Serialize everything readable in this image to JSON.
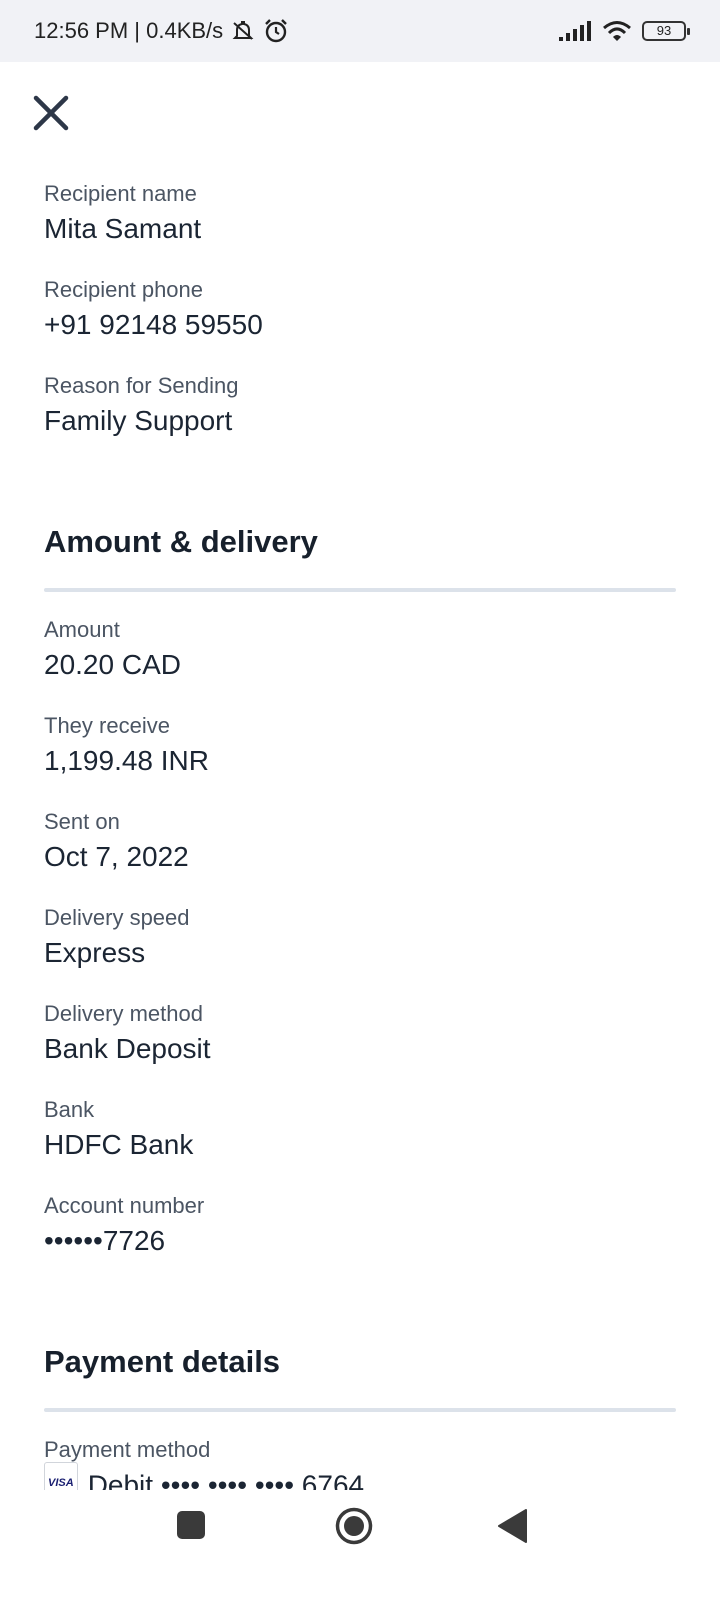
{
  "status_bar": {
    "time_speed": "12:56 PM | 0.4KB/s",
    "battery": "93",
    "icons": [
      "mute-icon",
      "alarm-icon",
      "signal-icon",
      "wifi-icon",
      "battery-icon"
    ]
  },
  "header": {
    "close_icon": "close-icon"
  },
  "recipient": [
    {
      "label": "Recipient name",
      "value": "Mita Samant"
    },
    {
      "label": "Recipient phone",
      "value": "+91 92148 59550"
    },
    {
      "label": "Reason for Sending",
      "value": "Family Support"
    }
  ],
  "amount_section": {
    "title": "Amount & delivery",
    "fields": [
      {
        "label": "Amount",
        "value": "20.20 CAD"
      },
      {
        "label": "They receive",
        "value": "1,199.48 INR"
      },
      {
        "label": "Sent on",
        "value": "Oct 7, 2022"
      },
      {
        "label": "Delivery speed",
        "value": "Express"
      },
      {
        "label": "Delivery method",
        "value": "Bank Deposit"
      },
      {
        "label": "Bank",
        "value": "HDFC Bank"
      },
      {
        "label": "Account number",
        "value": "••••••7726"
      }
    ]
  },
  "payment_section": {
    "title": "Payment details",
    "method_label": "Payment method",
    "card_brand": "VISA",
    "method_value": "Debit •••• •••• •••• 6764"
  },
  "nav": {
    "icons": [
      "recents-icon",
      "home-icon",
      "back-icon"
    ]
  },
  "colors": {
    "text": "#1b2533",
    "label": "#4b5563",
    "divider": "#dce2ea"
  }
}
